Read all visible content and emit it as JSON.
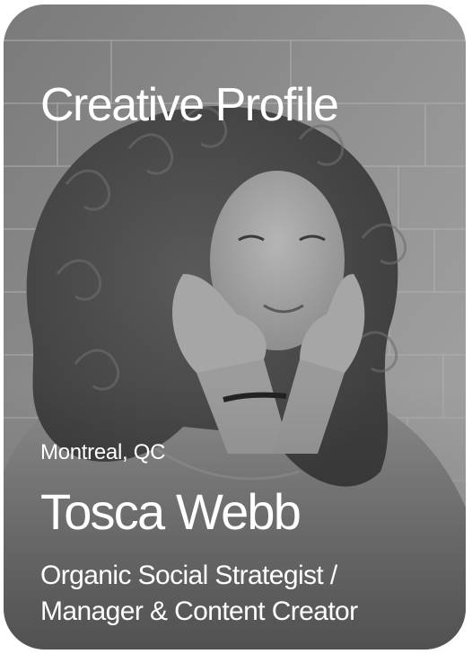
{
  "card": {
    "title": "Creative Profile",
    "location": "Montreal, QC",
    "name": "Tosca Webb",
    "role_line1": "Organic Social Strategist /",
    "role_line2": "Manager & Content Creator"
  },
  "colors": {
    "text": "#ffffff",
    "background": "#8a8a8a"
  }
}
